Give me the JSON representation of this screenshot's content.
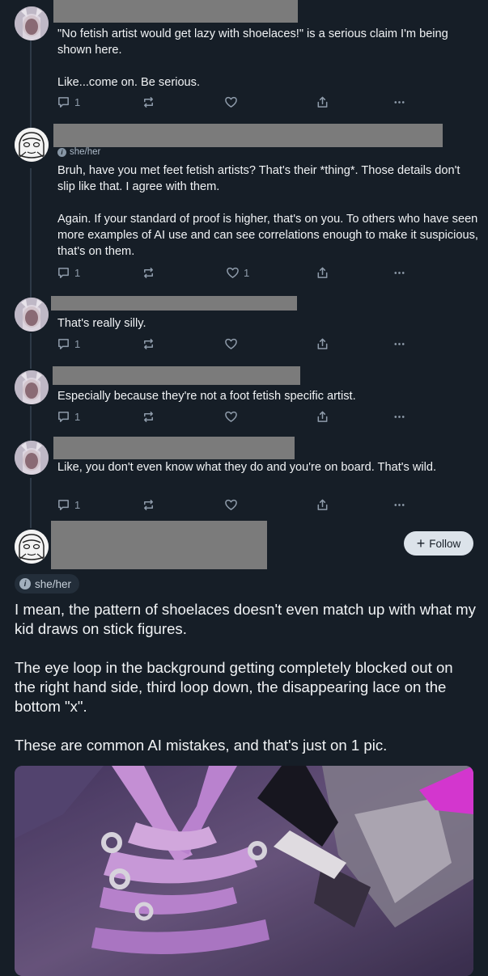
{
  "replies": [
    {
      "text": [
        "\"No fetish artist would get lazy with shoelaces!\" is a serious claim I'm being shown here.",
        "Like...come on. Be serious."
      ],
      "reply_count": "1",
      "like_count": ""
    },
    {
      "pronouns": "she/her",
      "text": [
        "Bruh, have you met feet fetish artists? That's their *thing*. Those details don't slip like that. I agree with them.",
        "Again. If your standard of proof is higher, that's on you. To others who have seen more examples of AI use and can see correlations enough to make it suspicious, that's on them."
      ],
      "reply_count": "1",
      "like_count": "1"
    },
    {
      "text": [
        "That's really silly."
      ],
      "reply_count": "1",
      "like_count": ""
    },
    {
      "text": [
        "Especially because they're not a foot fetish specific artist."
      ],
      "reply_count": "1",
      "like_count": ""
    },
    {
      "text": [
        "Like, you don't even know what they do and you're on board. That's wild."
      ],
      "reply_count": "1",
      "like_count": ""
    }
  ],
  "main_post": {
    "follow_label": "Follow",
    "pronouns": "she/her",
    "paragraphs": [
      "I mean, the pattern of shoelaces doesn't even match up with what my kid draws on stick figures.",
      "The eye loop in the background getting completely blocked out on the right hand side, third loop down, the disappearing lace on the bottom \"x\".",
      "These are common AI mistakes, and that's just on 1 pic."
    ]
  },
  "icons": {
    "reply": "reply-icon",
    "repost": "repost-icon",
    "like": "like-icon",
    "share": "share-icon",
    "more": "more-icon",
    "follow": "plus-icon",
    "pronoun": "info-icon"
  },
  "colors": {
    "background": "#161e27",
    "text": "#f1f3f5",
    "muted": "#8f9cab",
    "redaction": "#7b7b7b"
  }
}
